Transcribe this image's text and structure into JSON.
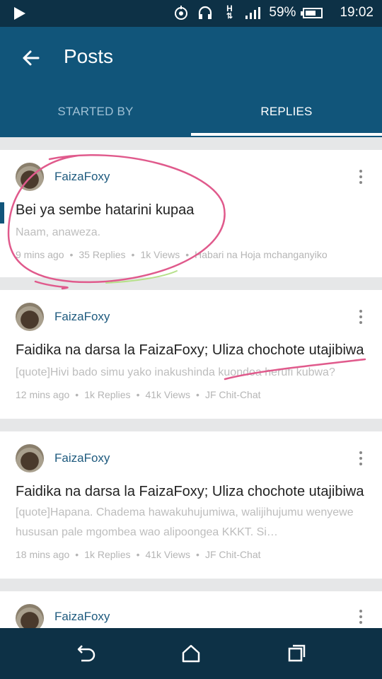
{
  "status": {
    "battery": "59%",
    "time": "19:02",
    "signal": "H"
  },
  "header": {
    "title": "Posts"
  },
  "tabs": [
    {
      "label": "STARTED BY"
    },
    {
      "label": "REPLIES"
    }
  ],
  "posts": [
    {
      "author": "FaizaFoxy",
      "title": "Bei ya sembe hatarini kupaa",
      "excerpt": "Naam, anaweza.",
      "time": "9 mins ago",
      "replies": "35 Replies",
      "views": "1k Views",
      "forum": "Habari na Hoja mchanganyiko"
    },
    {
      "author": "FaizaFoxy",
      "title": "Faidika na darsa la FaizaFoxy; Uliza chochote utajibiwa",
      "excerpt": "[quote]Hivi bado simu yako inakushinda kuondoa herufi kubwa?",
      "time": "12 mins ago",
      "replies": "1k Replies",
      "views": "41k Views",
      "forum": "JF Chit-Chat"
    },
    {
      "author": "FaizaFoxy",
      "title": "Faidika na darsa la FaizaFoxy; Uliza chochote utajibiwa",
      "excerpt": "[quote]Hapana. Chadema hawakuhujumiwa, walijihujumu wenyewe hususan pale mgombea wao alipoongea KKKT. Si…",
      "time": "18 mins ago",
      "replies": "1k Replies",
      "views": "41k Views",
      "forum": "JF Chit-Chat"
    },
    {
      "author": "FaizaFoxy"
    }
  ],
  "colors": {
    "appbar": "#11557a",
    "statusbar": "#0d3146",
    "author": "#1e5a7e",
    "annotation": "#e05a8c"
  }
}
